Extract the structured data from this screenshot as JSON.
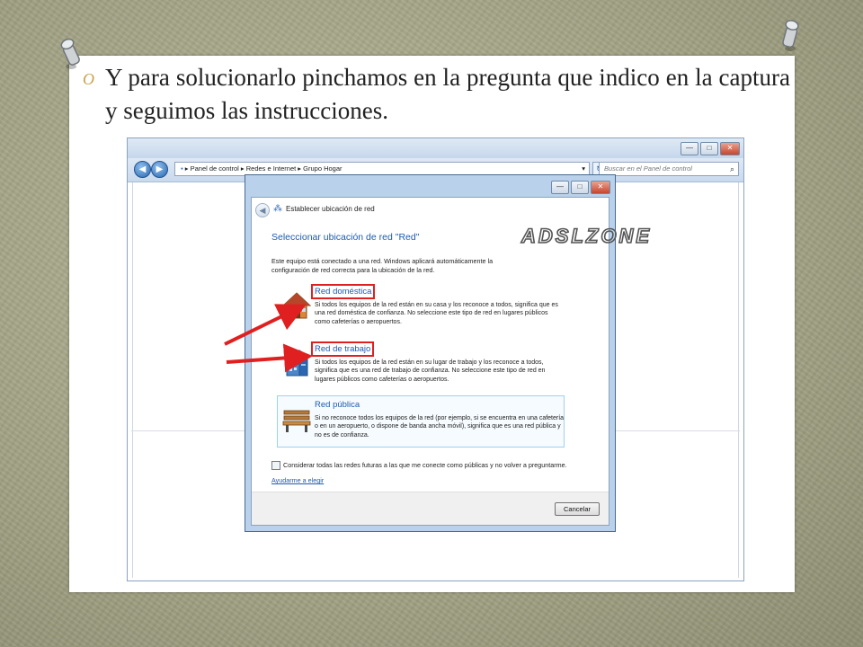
{
  "slide": {
    "bullet": "O",
    "text": "Y para solucionarlo pinchamos en la pregunta que indico en la captura y seguimos las instrucciones."
  },
  "explorer": {
    "breadcrumb": [
      "Panel de control",
      "Redes e Internet",
      "Grupo Hogar"
    ],
    "search_placeholder": "Buscar en el Panel de control",
    "window_buttons": {
      "minimize": "—",
      "maximize": "□",
      "close": "✕"
    }
  },
  "dialog": {
    "title": "Establecer ubicación de red",
    "heading": "Seleccionar ubicación de red \"Red\"",
    "intro": "Este equipo está conectado a una red. Windows aplicará automáticamente la configuración de red correcta para la ubicación de la red.",
    "options": [
      {
        "title": "Red doméstica",
        "description": "Si todos los equipos de la red están en su casa y los reconoce a todos, significa que es una red doméstica de confianza. No seleccione este tipo de red en lugares públicos como cafeterías o aeropuertos.",
        "icon": "house-icon"
      },
      {
        "title": "Red de trabajo",
        "description": "Si todos los equipos de la red están en su lugar de trabajo y los reconoce a todos, significa que es una red de trabajo de confianza. No seleccione este tipo de red en lugares públicos como cafeterías o aeropuertos.",
        "icon": "office-building-icon"
      },
      {
        "title": "Red pública",
        "description": "Si no reconoce todos los equipos de la red (por ejemplo, si se encuentra en una cafetería o en un aeropuerto, o dispone de banda ancha móvil), significa que es una red pública y no es de confianza.",
        "icon": "park-bench-icon"
      }
    ],
    "checkbox_label": "Considerar todas las redes futuras a las que me conecte como públicas y no volver a preguntarme.",
    "help_link": "Ayudarme a elegir",
    "cancel": "Cancelar"
  },
  "watermark": "ADSLZONE",
  "colors": {
    "highlight": "#e02020",
    "link": "#1e5bb0",
    "slide_bg": "#a8a88a"
  }
}
